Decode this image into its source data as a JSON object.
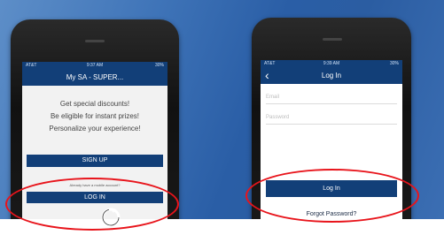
{
  "colors": {
    "background_blue": "#2a5ea6",
    "app_bar": "#123f78",
    "button": "#123f78",
    "highlight_red": "#e8141b"
  },
  "phone_left": {
    "status": {
      "carrier": "AT&T",
      "time": "9:37 AM",
      "battery": "30%"
    },
    "title": "My SA - SUPER...",
    "benefits": [
      "Get special discounts!",
      "Be eligible for instant prizes!",
      "Personalize your experience!"
    ],
    "signup_label": "SIGN UP",
    "already_text": "Already have a mobile account?",
    "login_label": "LOG IN"
  },
  "phone_right": {
    "status": {
      "carrier": "AT&T",
      "time": "9:39 AM",
      "battery": "30%"
    },
    "title": "Log In",
    "email_placeholder": "Email",
    "password_placeholder": "Password",
    "login_label": "Log In",
    "forgot_label": "Forgot Password?"
  },
  "icons": [
    "reload-icon",
    "back-icon"
  ]
}
